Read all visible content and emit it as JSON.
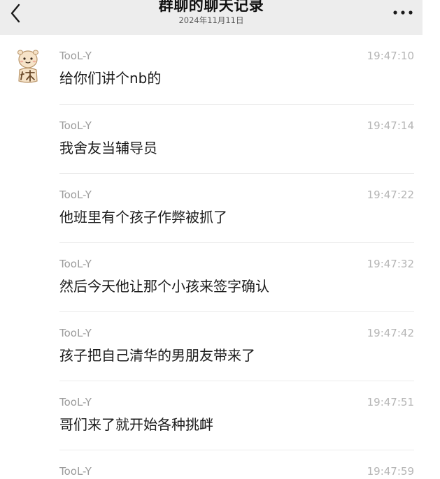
{
  "header": {
    "title": "群聊的聊天记录",
    "date": "2024年11月11日",
    "back_icon": "chevron-left-icon",
    "more_icon": "more-dots-icon"
  },
  "messages": [
    {
      "sender": "TooL-Y",
      "time": "19:47:10",
      "text": "给你们讲个nb的"
    },
    {
      "sender": "TooL-Y",
      "time": "19:47:14",
      "text": "我舍友当辅导员"
    },
    {
      "sender": "TooL-Y",
      "time": "19:47:22",
      "text": "他班里有个孩子作弊被抓了"
    },
    {
      "sender": "TooL-Y",
      "time": "19:47:32",
      "text": "然后今天他让那个小孩来签字确认"
    },
    {
      "sender": "TooL-Y",
      "time": "19:47:42",
      "text": "孩子把自己清华的男朋友带来了"
    },
    {
      "sender": "TooL-Y",
      "time": "19:47:51",
      "text": "哥们来了就开始各种挑衅"
    },
    {
      "sender": "TooL-Y",
      "time": "19:47:59",
      "text": ""
    }
  ],
  "colors": {
    "header_bg": "#ededed",
    "sender": "#9b9b9b",
    "time": "#b5b5b5",
    "text": "#1b1b1b",
    "divider": "#ececec"
  }
}
